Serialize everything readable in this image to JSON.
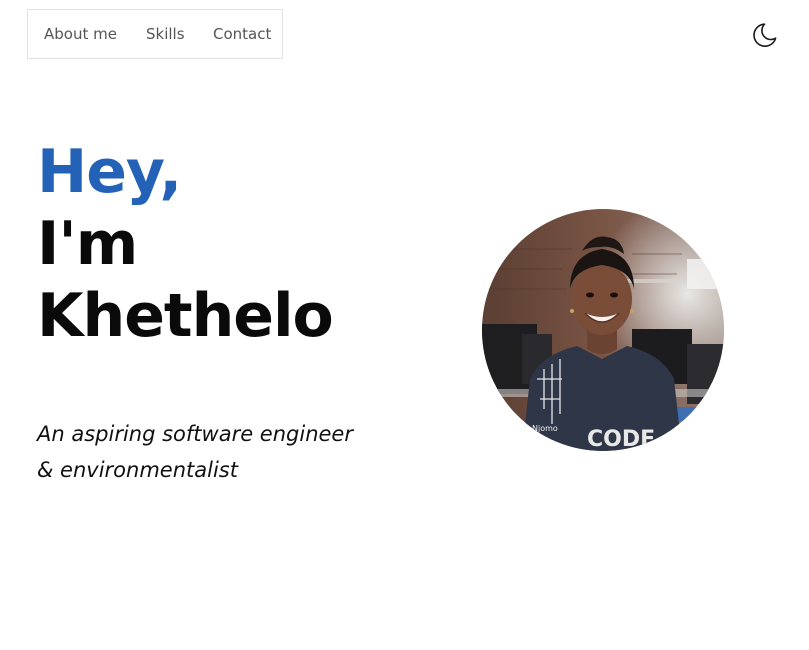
{
  "nav": {
    "items": [
      {
        "label": "About me"
      },
      {
        "label": "Skills"
      },
      {
        "label": "Contact"
      }
    ]
  },
  "theme_toggle": {
    "icon": "moon-icon"
  },
  "hero": {
    "greeting": "Hey,",
    "line1": "I'm",
    "line2": "Khethelo",
    "tagline_line1": "An aspiring software engineer",
    "tagline_line2": "& environmentalist"
  },
  "profile_photo": {
    "shirt_text": "CODE",
    "badge_text": "Njomo"
  },
  "colors": {
    "accent": "#2462b8",
    "text": "#0a0a0a",
    "nav_text": "#555555",
    "nav_border": "#e2e2e2",
    "background": "#ffffff"
  }
}
